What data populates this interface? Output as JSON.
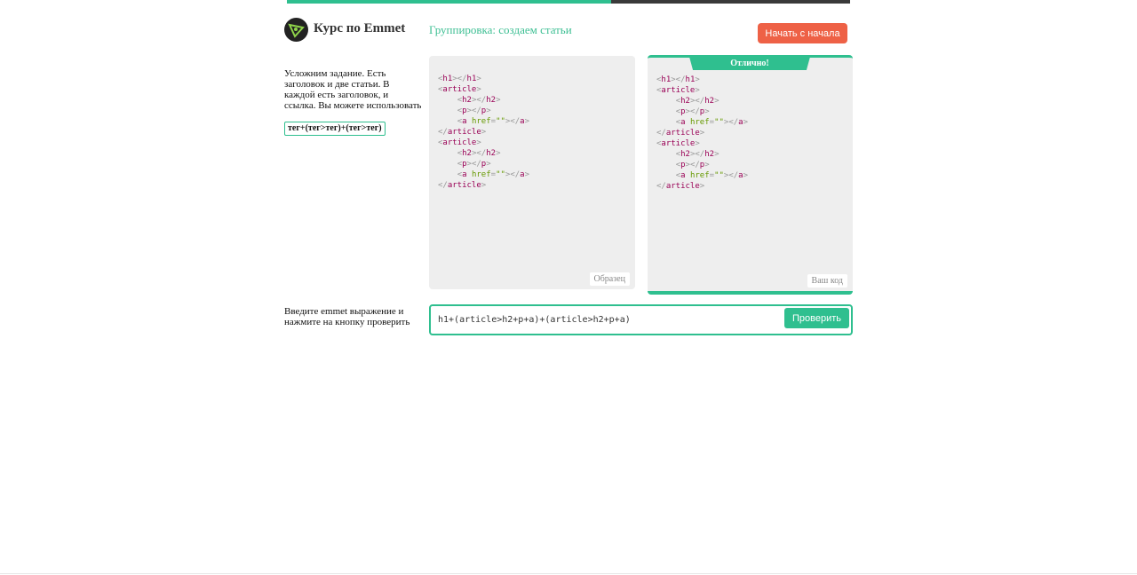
{
  "progress": {
    "fraction": 0.575,
    "fill_color": "#2fbf8f",
    "track_color": "#3a3a3a"
  },
  "header": {
    "logo_icon": "emmet-logo-icon",
    "app_title": "Курс по Emmet",
    "lesson_title": "Группировка: создаем статьи",
    "restart_label": "Начать с начала",
    "restart_color": "#ee6146"
  },
  "task": {
    "description": "Усложним задание. Есть заголовок и две статьи. В каждой есть заголовок, и ссылка. Вы можете использовать",
    "hint": "тег+(тег>тег)+(тег>тег)"
  },
  "sample_panel": {
    "label": "Образец"
  },
  "your_panel": {
    "label": "Ваш код",
    "status": "Отлично!"
  },
  "code_lines": [
    [
      [
        "p",
        "<"
      ],
      [
        "t",
        "h1"
      ],
      [
        "p",
        "></"
      ],
      [
        "t",
        "h1"
      ],
      [
        "p",
        ">"
      ]
    ],
    [
      [
        "p",
        "<"
      ],
      [
        "t",
        "article"
      ],
      [
        "p",
        ">"
      ]
    ],
    [
      [
        "sp",
        "    "
      ],
      [
        "p",
        "<"
      ],
      [
        "t",
        "h2"
      ],
      [
        "p",
        "></"
      ],
      [
        "t",
        "h2"
      ],
      [
        "p",
        ">"
      ]
    ],
    [
      [
        "sp",
        "    "
      ],
      [
        "p",
        "<"
      ],
      [
        "t",
        "p"
      ],
      [
        "p",
        "></"
      ],
      [
        "t",
        "p"
      ],
      [
        "p",
        ">"
      ]
    ],
    [
      [
        "sp",
        "    "
      ],
      [
        "p",
        "<"
      ],
      [
        "t",
        "a "
      ],
      [
        "a",
        "href"
      ],
      [
        "p",
        "="
      ],
      [
        "s",
        "\"\""
      ],
      [
        "p",
        "></"
      ],
      [
        "t",
        "a"
      ],
      [
        "p",
        ">"
      ]
    ],
    [
      [
        "p",
        "</"
      ],
      [
        "t",
        "article"
      ],
      [
        "p",
        ">"
      ]
    ],
    [
      [
        "p",
        "<"
      ],
      [
        "t",
        "article"
      ],
      [
        "p",
        ">"
      ]
    ],
    [
      [
        "sp",
        "    "
      ],
      [
        "p",
        "<"
      ],
      [
        "t",
        "h2"
      ],
      [
        "p",
        "></"
      ],
      [
        "t",
        "h2"
      ],
      [
        "p",
        ">"
      ]
    ],
    [
      [
        "sp",
        "    "
      ],
      [
        "p",
        "<"
      ],
      [
        "t",
        "p"
      ],
      [
        "p",
        "></"
      ],
      [
        "t",
        "p"
      ],
      [
        "p",
        ">"
      ]
    ],
    [
      [
        "sp",
        "    "
      ],
      [
        "p",
        "<"
      ],
      [
        "t",
        "a "
      ],
      [
        "a",
        "href"
      ],
      [
        "p",
        "="
      ],
      [
        "s",
        "\"\""
      ],
      [
        "p",
        "></"
      ],
      [
        "t",
        "a"
      ],
      [
        "p",
        ">"
      ]
    ],
    [
      [
        "p",
        "</"
      ],
      [
        "t",
        "article"
      ],
      [
        "p",
        ">"
      ]
    ]
  ],
  "input_section": {
    "label": "Введите emmet выражение и нажмите на кнопку проверить",
    "value": "h1+(article>h2+p+a)+(article>h2+p+a)",
    "check_label": "Проверить",
    "accent": "#2fbf8f"
  }
}
